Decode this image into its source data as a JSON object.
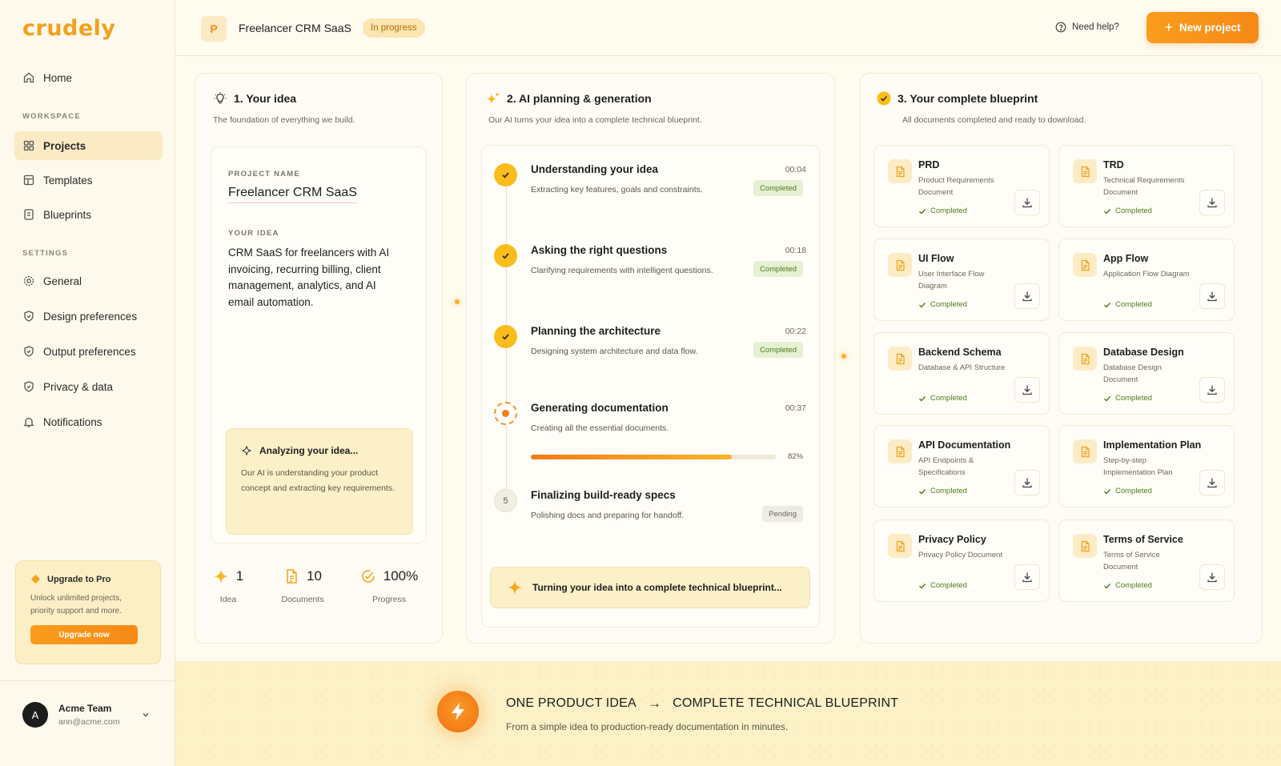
{
  "app": {
    "logo": "crudely"
  },
  "sidebar": {
    "home": "Home",
    "workspace_label": "WORKSPACE",
    "workspace": [
      "Projects",
      "Templates",
      "Blueprints"
    ],
    "settings_label": "SETTINGS",
    "settings": [
      "General",
      "Design preferences",
      "Output preferences",
      "Privacy & data",
      "Notifications"
    ],
    "upgrade": {
      "title": "Upgrade to Pro",
      "desc": "Unlock unlimited projects, priority support and more.",
      "button": "Upgrade now"
    },
    "user": {
      "initial": "A",
      "name": "Acme Team",
      "email": "ann@acme.com"
    }
  },
  "header": {
    "project_initial": "P",
    "project_name": "Freelancer CRM SaaS",
    "status": "In progress",
    "help": "Need help?",
    "new_project": "New project"
  },
  "idea": {
    "title": "1. Your idea",
    "subtitle": "The foundation of everything we build.",
    "project_name_label": "PROJECT NAME",
    "project_name": "Freelancer CRM SaaS",
    "idea_label": "YOUR IDEA",
    "idea_text": "CRM SaaS for freelancers with AI invoicing, recurring billing, client management, analytics, and AI email automation.",
    "analyzing_title": "Analyzing your idea...",
    "analyzing_desc": "Our AI is understanding your product concept and extracting key requirements.",
    "stats": [
      {
        "value": "1",
        "label": "Idea"
      },
      {
        "value": "10",
        "label": "Documents"
      },
      {
        "value": "100%",
        "label": "Progress"
      }
    ]
  },
  "planning": {
    "title": "2. AI planning & generation",
    "subtitle": "Our AI turns your idea into a complete technical blueprint.",
    "steps": [
      {
        "title": "Understanding your idea",
        "desc": "Extracting key features, goals and constraints.",
        "time": "00:04",
        "status": "Completed"
      },
      {
        "title": "Asking the right questions",
        "desc": "Clarifying requirements with intelligent questions.",
        "time": "00:18",
        "status": "Completed"
      },
      {
        "title": "Planning the architecture",
        "desc": "Designing system architecture and data flow.",
        "time": "00:22",
        "status": "Completed"
      },
      {
        "title": "Generating documentation",
        "desc": "Creating all the essential documents.",
        "time": "00:37",
        "progress": 82,
        "progress_label": "82%"
      },
      {
        "number": "5",
        "title": "Finalizing build-ready specs",
        "desc": "Polishing docs and preparing for handoff.",
        "status": "Pending"
      }
    ],
    "footer": "Turning your idea into a complete technical blueprint..."
  },
  "blueprint": {
    "title": "3. Your complete blueprint",
    "subtitle": "All documents completed and ready to download.",
    "docs": [
      {
        "name": "PRD",
        "desc": "Product Requirements Document",
        "status": "Completed"
      },
      {
        "name": "TRD",
        "desc": "Technical Requirements Document",
        "status": "Completed"
      },
      {
        "name": "UI Flow",
        "desc": "User Interface Flow Diagram",
        "status": "Completed"
      },
      {
        "name": "App Flow",
        "desc": "Application Flow Diagram",
        "status": "Completed"
      },
      {
        "name": "Backend Schema",
        "desc": "Database & API Structure",
        "status": "Completed"
      },
      {
        "name": "Database Design",
        "desc": "Database Design Document",
        "status": "Completed"
      },
      {
        "name": "API Documentation",
        "desc": "API Endpoints & Specifications",
        "status": "Completed"
      },
      {
        "name": "Implementation Plan",
        "desc": "Step-by-step Implementation Plan",
        "status": "Completed"
      },
      {
        "name": "Privacy Policy",
        "desc": "Privacy Policy Document",
        "status": "Completed"
      },
      {
        "name": "Terms of Service",
        "desc": "Terms of Service Document",
        "status": "Completed"
      }
    ]
  },
  "banner": {
    "left": "ONE PRODUCT IDEA",
    "arrow": "→",
    "right": "COMPLETE TECHNICAL BLUEPRINT",
    "subtitle": "From a simple idea to production-ready documentation in minutes."
  },
  "colors": {
    "accent": "#f68a16",
    "accent_yellow": "#f9bd1c",
    "success": "#4d7b1c",
    "background": "#fefbef"
  }
}
